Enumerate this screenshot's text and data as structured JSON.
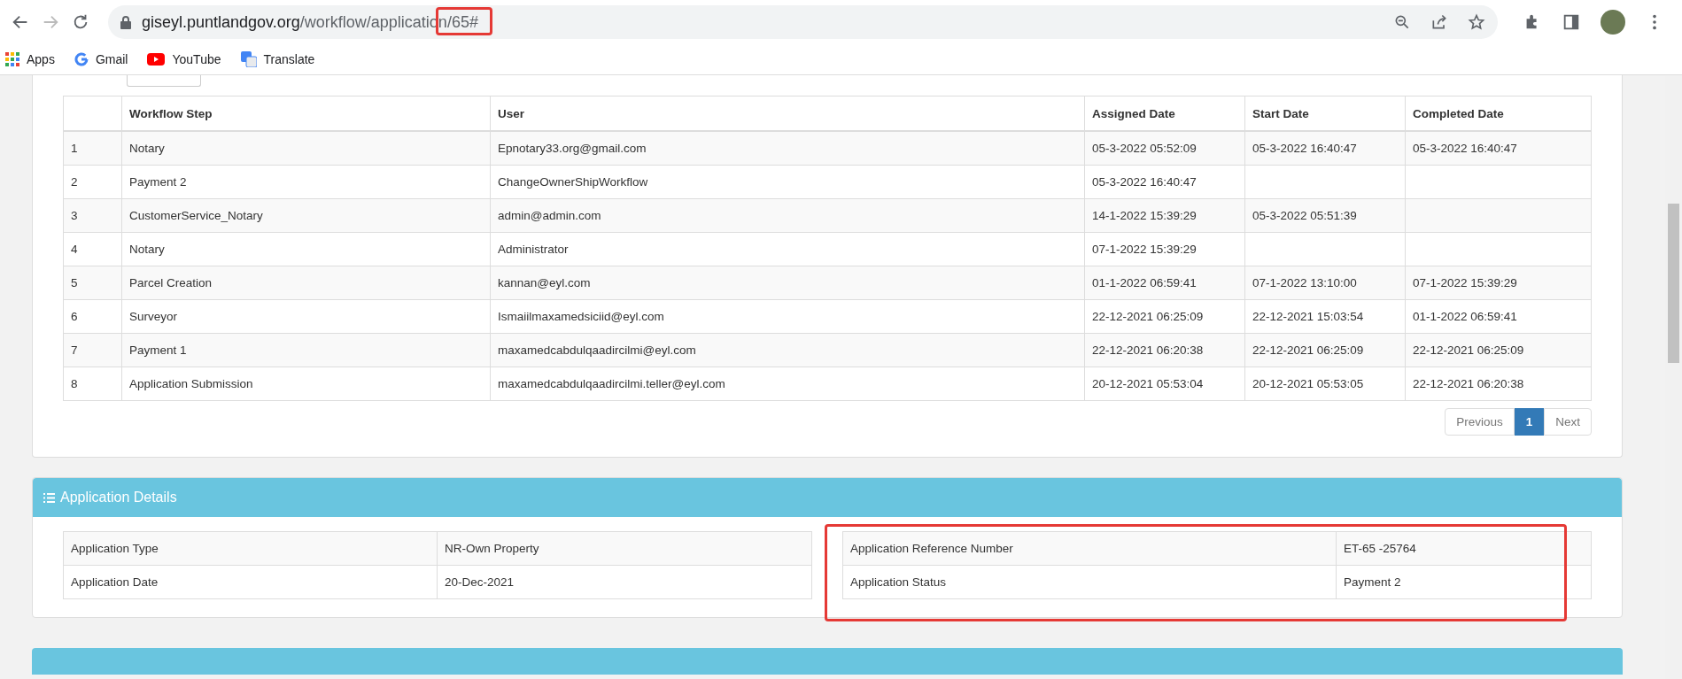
{
  "browser": {
    "url_host": "giseyl.puntlandgov.org",
    "url_path": "/workflow/application/65#",
    "bookmarks": [
      {
        "label": "Apps",
        "kind": "apps"
      },
      {
        "label": "Gmail",
        "kind": "gmail"
      },
      {
        "label": "YouTube",
        "kind": "youtube"
      },
      {
        "label": "Translate",
        "kind": "translate"
      }
    ]
  },
  "workflow_table": {
    "columns": [
      "",
      "Workflow Step",
      "User",
      "Assigned Date",
      "Start Date",
      "Completed Date"
    ],
    "rows": [
      [
        "1",
        "Notary",
        "Epnotary33.org@gmail.com",
        "05-3-2022 05:52:09",
        "05-3-2022 16:40:47",
        "05-3-2022 16:40:47"
      ],
      [
        "2",
        "Payment 2",
        "ChangeOwnerShipWorkflow",
        "05-3-2022 16:40:47",
        "",
        ""
      ],
      [
        "3",
        "CustomerService_Notary",
        "admin@admin.com",
        "14-1-2022 15:39:29",
        "05-3-2022 05:51:39",
        ""
      ],
      [
        "4",
        "Notary",
        "Administrator",
        "07-1-2022 15:39:29",
        "",
        ""
      ],
      [
        "5",
        "Parcel Creation",
        "kannan@eyl.com",
        "01-1-2022 06:59:41",
        "07-1-2022 13:10:00",
        "07-1-2022 15:39:29"
      ],
      [
        "6",
        "Surveyor",
        "Ismaiilmaxamedsiciid@eyl.com",
        "22-12-2021 06:25:09",
        "22-12-2021 15:03:54",
        "01-1-2022 06:59:41"
      ],
      [
        "7",
        "Payment 1",
        "maxamedcabdulqaadircilmi@eyl.com",
        "22-12-2021 06:20:38",
        "22-12-2021 06:25:09",
        "22-12-2021 06:25:09"
      ],
      [
        "8",
        "Application Submission",
        "maxamedcabdulqaadircilmi.teller@eyl.com",
        "20-12-2021 05:53:04",
        "20-12-2021 05:53:05",
        "22-12-2021 06:20:38"
      ]
    ],
    "pagination": {
      "previous": "Previous",
      "pages": [
        {
          "label": "1",
          "selected": true
        }
      ],
      "next": "Next"
    }
  },
  "application_details": {
    "title": "Application Details",
    "left": [
      {
        "label": "Application Type",
        "value": "NR-Own Property"
      },
      {
        "label": "Application Date",
        "value": "20-Dec-2021"
      }
    ],
    "right": [
      {
        "label": "Application Reference Number",
        "value": "ET-65 -25764"
      },
      {
        "label": "Application Status",
        "value": "Payment 2"
      }
    ]
  }
}
